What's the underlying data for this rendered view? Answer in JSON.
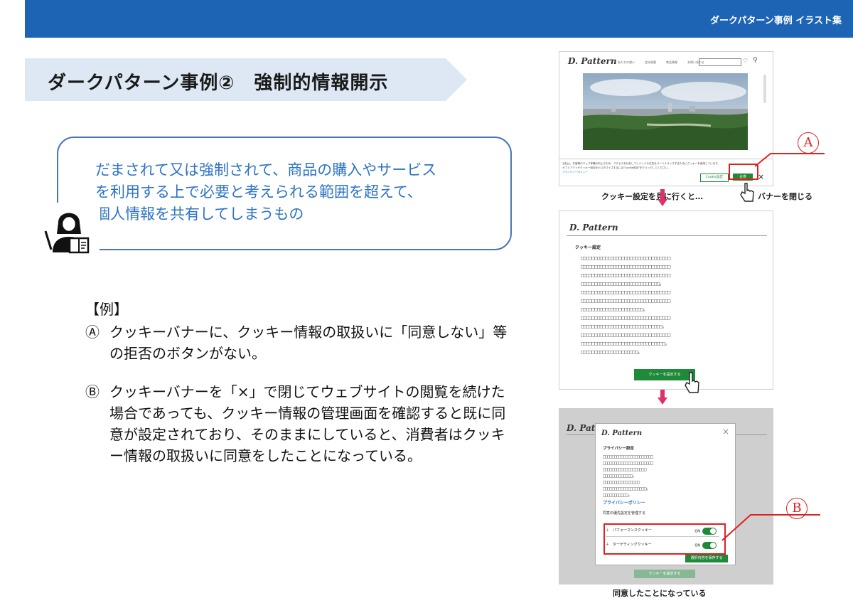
{
  "header": {
    "right_title": "ダークパターン事例 イラスト集"
  },
  "slide": {
    "title": "ダークパターン事例②　強制的情報開示"
  },
  "definition": {
    "lines": [
      "だまされて又は強制されて、商品の購入やサービス",
      "を利用する上で必要と考えられる範囲を超えて、",
      "個人情報を共有してしまうもの"
    ]
  },
  "example": {
    "heading": "【例】",
    "items": [
      {
        "mark": "Ⓐ",
        "text": "クッキーバナーに、クッキー情報の取扱いに「同意しない」等の拒否のボタンがない。"
      },
      {
        "mark": "Ⓑ",
        "text": "クッキーバナーを「×」で閉じてウェブサイトの閲覧を続けた場合であっても、クッキー情報の管理画面を確認すると既に同意が設定されており、そのままにしていると、消費者はクッキー情報の取扱いに同意をしたことになっている。"
      }
    ]
  },
  "screen1": {
    "brand": "D. Pattern",
    "nav": [
      "私たちの想い",
      "会社概要",
      "商品情報",
      "お問い合わせ"
    ],
    "banner_lines": [
      "当社は、お客様のウェブ体験の向上のため、アクセスを分析しコンテンツや広告をパーソナライズするためにクッキーを使用しています。",
      "オプトアウトやクッキー設定をカスタマイズするには\"Cookie設定\"をクリックしてください。"
    ],
    "privacy_link": "プライバシーポリシー",
    "cookie_settings_btn": "Cookie設定",
    "agree_btn": "合意",
    "close_x": "×"
  },
  "caption1": "クッキー設定を見に行くと…",
  "caption_close": "バナーを閉じる",
  "label_a": "A",
  "screen2": {
    "brand": "D. Pattern",
    "section_title": "クッキー設定",
    "text_lines": [
      "□□□□□□□□□□□□□□□□□□□□□□□□□□□□□□□□□",
      "□□□□□□□□□□□□□□□□□□□□□□□□□□□□□□□□□",
      "□□□□□□□□□□□□□□□□□□□□□□□□□□□□□□□□□",
      "□□□□□□□□□□□□□□□□□□□□□□□□□□□□□。",
      "□□□□□□□□□□□□□□□□□□□□□□□□□□□□□□□□□",
      "□□□□□□□□□□□□□□□□□□□□□□□□□□□□□□□□□",
      "□□□□□□□□□□□□□□□□□□□□□□□。",
      "□□□□□□□□□□□□□□□□□□□□□□□□□□□□□□□□□",
      "□□□□□□□□□□□□□□□□□□□□□□□□□□□□□□。",
      "□□□□□□□□□□□□□□□□□□□□□□□□□□□□□□□□□",
      "□□□□□□□□□□□□□□□□□□□□□□□□□□□□□□□。",
      "□□□□□□□□□□□□□□□□□□□□□。"
    ],
    "set_btn": "クッキーを設定する"
  },
  "screen3": {
    "brand": "D. Pattern",
    "modal_title": "プライバシー設定",
    "close_x": "×",
    "text_lines": [
      "□□□□□□□□□□□□□□□□□□□□□□",
      "□□□□□□□□□□□□□□□□□□□□□□",
      "□□□□□□□□□□□□□□□□□□□",
      "□□□□□□□□□□□□□。",
      "□□□□□□□□□□□□□□□□",
      "□□□□□□□□□□□□□□□□□□□。",
      "□□□□□□□□□□□。"
    ],
    "privacy_link": "プライバシーポリシー",
    "consent_heading": "同意の優先設定を管理する",
    "toggles": [
      {
        "label": "＋　パフォーマンスクッキー",
        "state": "ON"
      },
      {
        "label": "＋　ターゲティングクッキー",
        "state": "ON"
      }
    ],
    "save_btn": "選択内容を保存する",
    "bg_btn": "クッキーを設定する"
  },
  "label_b": "B",
  "caption_bottom": "同意したことになっている",
  "colors": {
    "header_blue": "#1e64b4",
    "title_band": "#dde8f4",
    "def_text": "#2e74c4",
    "callout_red": "#e02020",
    "button_green": "#1e8a3a",
    "arrow_pink": "#e0306a"
  }
}
